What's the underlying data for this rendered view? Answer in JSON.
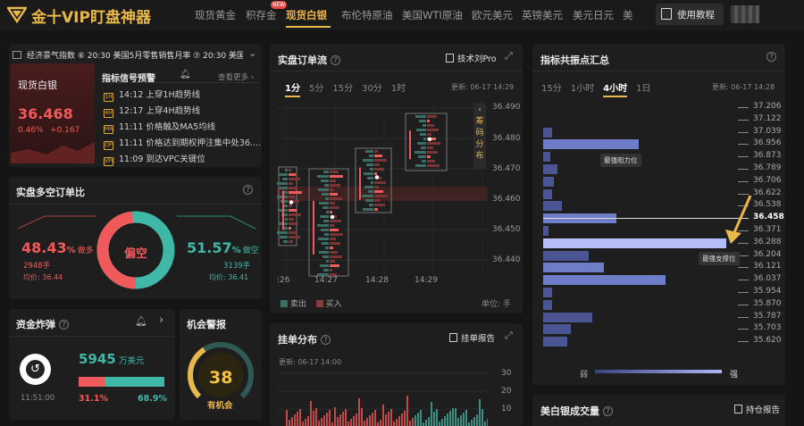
{
  "app": {
    "title": "金十VIP盯盘神器"
  },
  "nav": {
    "items": [
      "现货黄金",
      "积存金",
      "现货白银",
      "布伦特原油",
      "美国WTI原油",
      "欧元美元",
      "英镑美元",
      "美元日元",
      "美"
    ],
    "new_badge": "NEW",
    "tutorial": "使用教程"
  },
  "ticker": {
    "text": "经济景气指数 ⑥ 20:30 美国5月零售销售月率 ⑦ 20:30 美国"
  },
  "silver": {
    "name": "现货白银",
    "price": "36.468",
    "change_pct": "0.46%",
    "change": "+0.167"
  },
  "signals": {
    "title": "指标信号预警",
    "more": "查看更多",
    "rows": [
      {
        "time": "14:12",
        "text": "上穿1H趋势线"
      },
      {
        "time": "12:17",
        "text": "上穿4H趋势线"
      },
      {
        "time": "11:11",
        "text": "价格触及MA5均线"
      },
      {
        "time": "11:11",
        "text": "价格达到期权押注集中处36...."
      },
      {
        "time": "11:09",
        "text": "到达VPC关键位"
      }
    ]
  },
  "ratio": {
    "title": "实盘多空订单比",
    "short_pct": "48.43",
    "short_label": "做多",
    "short_lots": "2948手",
    "short_avg": "均价: 36.44",
    "long_pct": "51.57",
    "long_label": "做空",
    "long_lots": "3139手",
    "long_avg": "均价: 36.41",
    "center": "偏空",
    "pct_unit": "%"
  },
  "bomb": {
    "title": "资金炸弹",
    "amount": "5945",
    "unit": "万美元",
    "time": "11:51:00",
    "red_pct": "31.1%",
    "green_pct": "68.9%",
    "red_fraction": 0.311
  },
  "alert": {
    "title": "机会警报",
    "score": "38",
    "label": "有机会",
    "level_fraction": 0.38
  },
  "orderflow": {
    "title": "实盘订单流",
    "pro": "技术刘Pro",
    "tabs": [
      "1分",
      "5分",
      "15分",
      "30分",
      "1时"
    ],
    "active_tab": 0,
    "updated": "更新: 06-17 14:29",
    "side_label": [
      "筹",
      "码",
      "分",
      "布"
    ],
    "yticks": [
      "36.490",
      "36.480",
      "36.470",
      "36.460",
      "36.450",
      "36.440"
    ],
    "xticks": [
      ":26",
      "14:27",
      "14:28",
      "14:29"
    ],
    "legend_sell": "卖出",
    "legend_buy": "买入",
    "unit": "单位: 手"
  },
  "orderbook": {
    "title": "挂单分布",
    "report": "挂单报告",
    "updated": "更新: 06-17 14:00",
    "yticks": [
      "30",
      "20",
      "10"
    ]
  },
  "resonance": {
    "title": "指标共振点汇总",
    "tabs": [
      "15分",
      "1小时",
      "4小时",
      "1日"
    ],
    "active_tab": 2,
    "updated": "更新: 06-17 14:28",
    "prices": [
      "37.206",
      "37.122",
      "37.039",
      "36.956",
      "36.873",
      "36.789",
      "36.706",
      "36.622",
      "36.538",
      "36.458",
      "36.371",
      "36.288",
      "36.204",
      "36.121",
      "36.037",
      "35.954",
      "35.870",
      "35.787",
      "35.703",
      "35.620"
    ],
    "current": "36.458",
    "resist_label": "最强阻力位",
    "support_label": "最强支撑位",
    "weak": "弱",
    "strong": "强",
    "bars": [
      0,
      0,
      0.05,
      0.52,
      0.04,
      0.08,
      0.06,
      0.05,
      0.1,
      0.4,
      0.03,
      1.0,
      0.25,
      0.33,
      0.67,
      0.05,
      0.05,
      0.27,
      0.15,
      0.13
    ]
  },
  "volume": {
    "title": "美白银成交量",
    "report": "持仓报告"
  },
  "colors": {
    "red": "#f05a5a",
    "green": "#3fb8a8",
    "gold": "#e8b84a",
    "bar": "#5c6bb8"
  }
}
